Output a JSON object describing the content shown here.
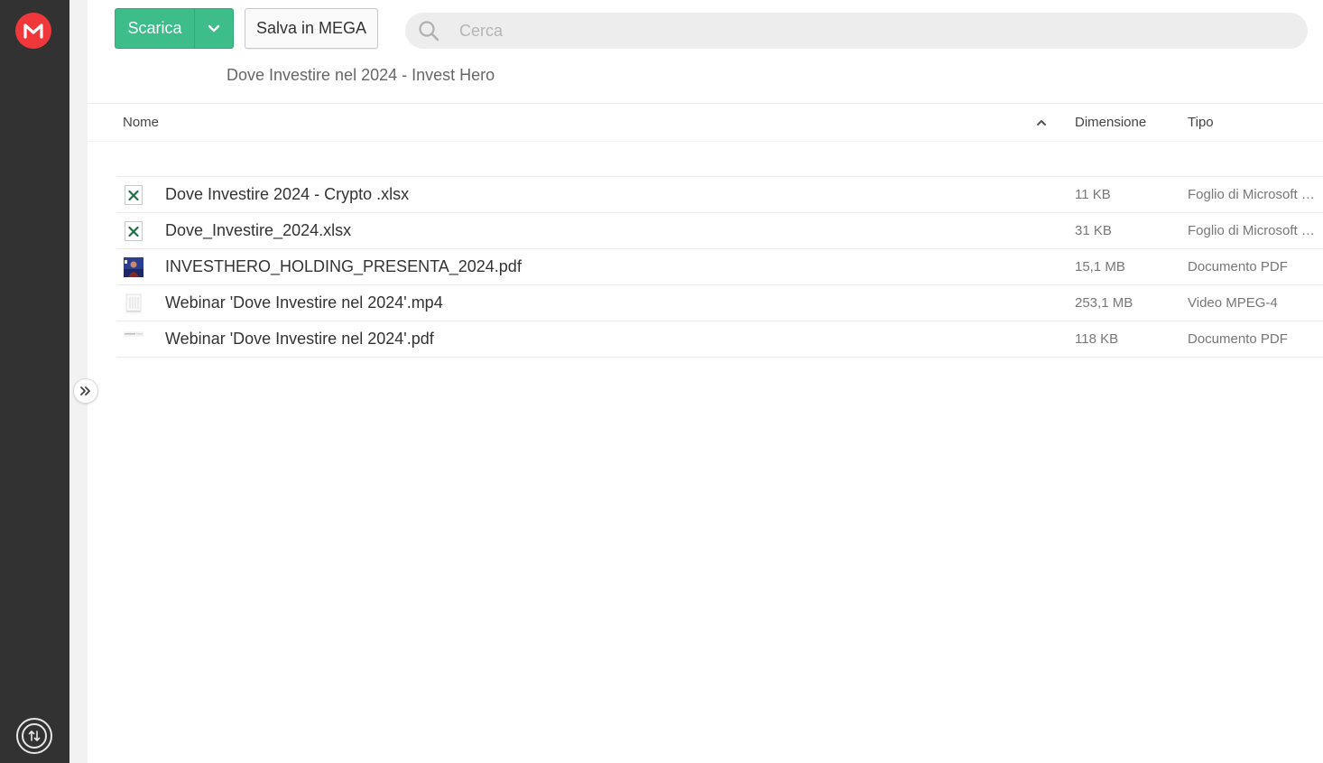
{
  "toolbar": {
    "download_label": "Scarica",
    "save_label": "Salva in MEGA"
  },
  "search": {
    "placeholder": "Cerca"
  },
  "folder": {
    "title": "Dove Investire nel 2024 - Invest Hero"
  },
  "table": {
    "headers": {
      "name": "Nome",
      "size": "Dimensione",
      "type": "Tipo"
    },
    "rows": [
      {
        "name": "Dove Investire 2024 - Crypto .xlsx",
        "size": "11 KB",
        "type": "Foglio di Microsoft Excel",
        "icon": "excel-icon"
      },
      {
        "name": "Dove_Investire_2024.xlsx",
        "size": "31 KB",
        "type": "Foglio di Microsoft Excel",
        "icon": "excel-icon"
      },
      {
        "name": "INVESTHERO_HOLDING_PRESENTA_2024.pdf",
        "size": "15,1 MB",
        "type": "Documento PDF",
        "icon": "pdf-thumbnail-icon"
      },
      {
        "name": "Webinar 'Dove Investire nel 2024'.mp4",
        "size": "253,1 MB",
        "type": "Video MPEG-4",
        "icon": "video-thumbnail-icon"
      },
      {
        "name": "Webinar 'Dove Investire nel 2024'.pdf",
        "size": "118 KB",
        "type": "Documento PDF",
        "icon": "pdf-thumbnail-icon"
      }
    ]
  },
  "colors": {
    "rail": "#323232",
    "brand_red": "#f0373a",
    "accent_green": "#3dbd8a",
    "excel_green": "#1e7145"
  }
}
